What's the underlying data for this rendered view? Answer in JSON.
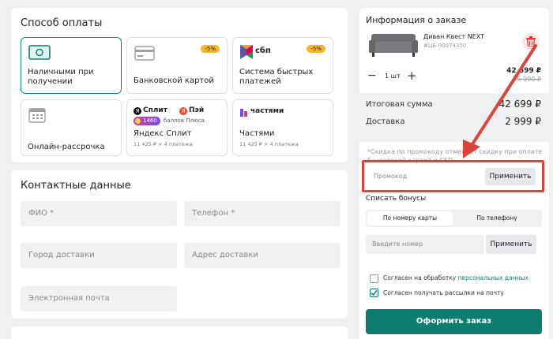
{
  "payment": {
    "title": "Способ оплаты",
    "methods": [
      {
        "label": "Наличными при получении",
        "selected": true
      },
      {
        "label": "Банковской картой",
        "badge": "-5%"
      },
      {
        "label": "Система быстрых платежей",
        "badge": "-5%",
        "logo_text": "сбп"
      },
      {
        "label": "Онлайн-рассрочка"
      },
      {
        "label": "Яндекс Сплит",
        "logo_split": "Сплит",
        "logo_pay": "Пэй",
        "points": "1460",
        "points_text": "баллов Плюса",
        "installments": "11 425 ₽ × 4 платежа"
      },
      {
        "label": "Частями",
        "logo_text": "частями",
        "installments": "11 425 ₽ × 4 платежа"
      }
    ]
  },
  "contacts": {
    "title": "Контактные данные",
    "placeholders": {
      "name": "ФИО *",
      "phone": "Телефон *",
      "city": "Город доставки",
      "address": "Адрес доставки",
      "email": "Электронная почта"
    }
  },
  "order": {
    "title": "Информация о заказе",
    "product_name": "Диван Квест NEXT",
    "product_sku": "#ЦБ-00074350",
    "price": "42 699 ₽",
    "old_price": "75 999 ₽",
    "qty": "1 шт",
    "minus": "−",
    "plus": "+",
    "total_label": "Итоговая сумма",
    "total_value": "42 699 ₽",
    "delivery_label": "Доставка",
    "delivery_value": "2 999 ₽",
    "note": "*Скидка по промокоду отменяет скидку при оплате банковской картой и СБП",
    "promo_placeholder": "Промокод",
    "apply_label": "Применить",
    "bonus_title": "Списать бонусы",
    "bonus_tabs": [
      "По номеру карты",
      "По телефону"
    ],
    "number_placeholder": "Введите номер",
    "apply2_label": "Применить",
    "consent1_text": "Согласен на обработку ",
    "consent1_link": "персональных данных",
    "consent2_text": "Согласен получать рассылки на почту",
    "submit_label": "Оформить заказ"
  },
  "colors": {
    "accent": "#0e7d6f",
    "highlight": "#d9463e",
    "badge": "#f7b52c"
  }
}
